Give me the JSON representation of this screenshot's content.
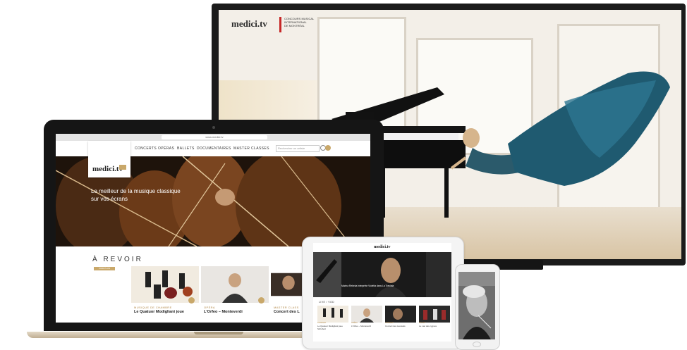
{
  "tv": {
    "logo": "medici.tv",
    "partner_line1": "CONCOURS MUSICAL",
    "partner_line2": "INTERNATIONAL",
    "partner_line3": "DE MONTRÉAL"
  },
  "laptop": {
    "url": "www.medici.tv",
    "search_placeholder": "Rechercher un artiste",
    "nav": [
      "CONCERTS",
      "OPÉRAS",
      "BALLETS",
      "DOCUMENTAIRES",
      "MASTER CLASSES"
    ],
    "logo": "medici.tv",
    "hero_text": "Le meilleur de la musique classique sur vos écrans",
    "section_title": "À REVOIR",
    "section_tag": "VOIR PLUS",
    "cards": [
      {
        "category": "MUSIQUE DE CHAMBRE",
        "title": "Le Quatuor Modigliani joue"
      },
      {
        "category": "OPÉRA",
        "title": "L'Orfeo – Monteverdi"
      },
      {
        "category": "MASTER CLASS",
        "title": "Concert des L"
      }
    ]
  },
  "tablet": {
    "logo": "medici.tv",
    "hero_caption": "Marina Rebeka interprète Violetta dans La Traviata",
    "list_title": "LIVE / VOD",
    "items": [
      {
        "category": "CONCERT",
        "title": "Le Quatuor Modigliani joue Schubert"
      },
      {
        "category": "OPÉRA",
        "title": "L'Orfeo – Monteverdi"
      },
      {
        "category": "CONCERT",
        "title": "Concert des Lauréats"
      },
      {
        "category": "BALLET",
        "title": "Le Lac des cygnes"
      }
    ]
  },
  "colors": {
    "accent": "#c9a86a",
    "partner_red": "#c62828"
  }
}
